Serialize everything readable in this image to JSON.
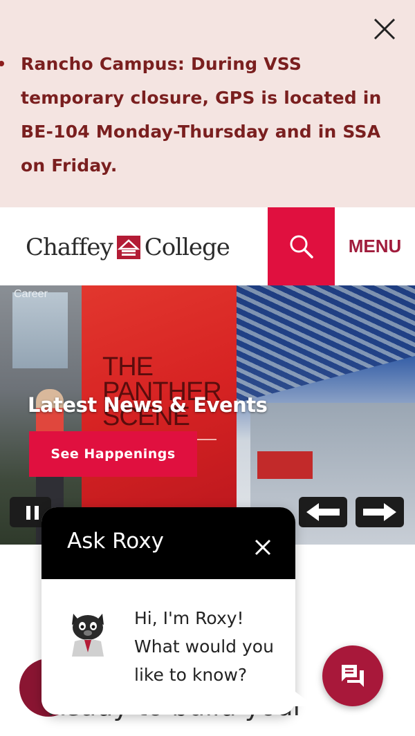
{
  "alert": {
    "message": "Rancho Campus: During VSS temporary closure, GPS is located in BE-104 Monday-Thursday and in SSA on Friday.",
    "close_icon": "close-icon"
  },
  "header": {
    "logo_left": "Chaffey",
    "logo_right": "College",
    "search_icon": "search-icon",
    "menu_label": "MENU"
  },
  "hero": {
    "poster_label": "Career",
    "graphic_text": "THE\nPANTHER\nSCENE",
    "title": "Latest News & Events",
    "cta_label": "See Happenings",
    "pause_icon": "pause-icon",
    "prev_icon": "arrow-left-icon",
    "next_icon": "arrow-right-icon"
  },
  "below": {
    "heading_partial": "Ready to build your"
  },
  "chat": {
    "title": "Ask Roxy",
    "greeting": "Hi, I'm Roxy! What would you like to know?",
    "close_icon": "close-icon",
    "fab_icon": "chat-icon"
  },
  "colors": {
    "alert_bg": "#f4e4e1",
    "alert_text": "#7a1f1f",
    "brand_red": "#e0103f",
    "brand_maroon": "#a8183a"
  }
}
